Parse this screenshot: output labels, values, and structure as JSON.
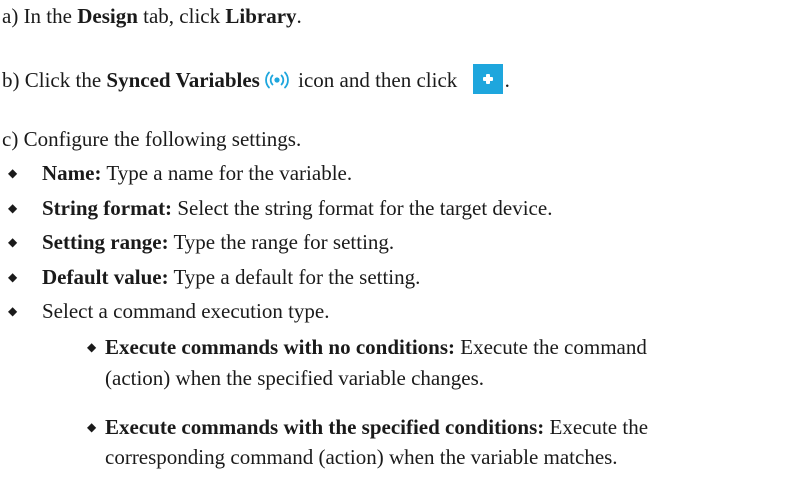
{
  "steps": {
    "a": {
      "prefix": "a) In the ",
      "tab": "Design",
      "mid": " tab, click ",
      "target": "Library",
      "suffix": "."
    },
    "b": {
      "prefix": "b) Click the ",
      "target": "Synced Variables",
      "mid": " icon and then click ",
      "suffix": "."
    },
    "c": {
      "text": "c) Configure the following settings."
    }
  },
  "settings": [
    {
      "label": "Name:",
      "text": " Type a name for the variable."
    },
    {
      "label": "String format:",
      "text": " Select the string format for the target device."
    },
    {
      "label": "Setting range:",
      "text": " Type the range for setting."
    },
    {
      "label": "Default value:",
      "text": " Type a default for the setting."
    },
    {
      "label": "",
      "text": "Select a command execution type."
    }
  ],
  "execution_types": [
    {
      "label": "Execute commands with no conditions:",
      "text_line1": " Execute the command",
      "text_line2": "(action) when the specified variable changes."
    },
    {
      "label": "Execute commands with the specified conditions:",
      "text_line1": " Execute the",
      "text_line2": "corresponding command (action) when the variable matches."
    }
  ],
  "icons": {
    "synced_variables": "synced-variables-icon",
    "add": "plus-icon"
  },
  "colors": {
    "accent": "#1ea6dd",
    "text": "#1a1a1a"
  }
}
